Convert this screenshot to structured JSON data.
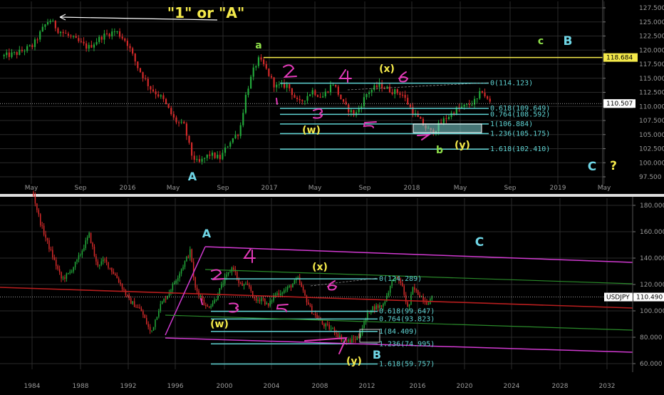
{
  "colors": {
    "background": "#000000",
    "grid": "#2a2a2a",
    "axis_text": "#9a9a9a",
    "separator": "#dddddd",
    "candle_up": "#22a83a",
    "candle_down": "#d42a2a",
    "fib": "#5fd3d3",
    "magenta": "#d23ad2",
    "cyan_label": "#6fd6e6",
    "yellow": "#f4e94a",
    "green_label": "#8fe04a",
    "pink_wave": "#e23ab8",
    "channel_green": "#2a8a2a",
    "trend_red": "#b81e1e",
    "price_line": "#cfcfcf"
  },
  "chart_data": [
    {
      "type": "candlestick",
      "symbol": "USDJPY",
      "last_price_label": "110.507",
      "marked_level_label": "118.684",
      "y_ticks": [
        "127.500",
        "125.000",
        "122.500",
        "120.000",
        "117.500",
        "115.000",
        "112.500",
        "110.000",
        "107.500",
        "105.000",
        "102.500",
        "100.000",
        "97.500"
      ],
      "ylim": [
        96.5,
        128.3
      ],
      "x_ticks": [
        "May",
        "Sep",
        "2016",
        "May",
        "Sep",
        "2017",
        "May",
        "Sep",
        "2018",
        "May",
        "Sep",
        "2019",
        "May"
      ],
      "xlim": [
        2015.08,
        2019.46
      ],
      "price_path": [
        [
          2015.1,
          118.9
        ],
        [
          2015.2,
          119.4
        ],
        [
          2015.32,
          120.8
        ],
        [
          2015.4,
          124.2
        ],
        [
          2015.44,
          125.5
        ],
        [
          2015.5,
          123.6
        ],
        [
          2015.62,
          121.9
        ],
        [
          2015.72,
          120.4
        ],
        [
          2015.82,
          122.4
        ],
        [
          2015.92,
          123.4
        ],
        [
          2016.0,
          121.5
        ],
        [
          2016.08,
          117.0
        ],
        [
          2016.17,
          113.3
        ],
        [
          2016.26,
          111.4
        ],
        [
          2016.35,
          107.5
        ],
        [
          2016.42,
          106.5
        ],
        [
          2016.47,
          101.5
        ],
        [
          2016.52,
          99.8
        ],
        [
          2016.6,
          101.5
        ],
        [
          2016.68,
          100.8
        ],
        [
          2016.75,
          103.8
        ],
        [
          2016.82,
          105.5
        ],
        [
          2016.87,
          112.5
        ],
        [
          2016.93,
          117.0
        ],
        [
          2016.96,
          118.3
        ],
        [
          2017.0,
          117.2
        ],
        [
          2017.08,
          113.5
        ],
        [
          2017.17,
          113.8
        ],
        [
          2017.25,
          110.4
        ],
        [
          2017.35,
          112.8
        ],
        [
          2017.42,
          111.6
        ],
        [
          2017.5,
          114.2
        ],
        [
          2017.58,
          110.2
        ],
        [
          2017.66,
          108.4
        ],
        [
          2017.75,
          112.5
        ],
        [
          2017.84,
          113.8
        ],
        [
          2017.92,
          112.8
        ],
        [
          2018.0,
          112.3
        ],
        [
          2018.08,
          109.0
        ],
        [
          2018.17,
          106.3
        ],
        [
          2018.22,
          105.3
        ],
        [
          2018.3,
          107.5
        ],
        [
          2018.4,
          109.5
        ],
        [
          2018.48,
          110.2
        ],
        [
          2018.55,
          111.2
        ],
        [
          2018.58,
          113.0
        ],
        [
          2018.62,
          111.2
        ],
        [
          2018.65,
          110.5
        ]
      ],
      "fib_levels": [
        {
          "label": "0(114.123)",
          "value": 114.123
        },
        {
          "label": "0.618(109.649)",
          "value": 109.649
        },
        {
          "label": "0.764(108.592)",
          "value": 108.592
        },
        {
          "label": "1(106.884)",
          "value": 106.884
        },
        {
          "label": "1.236(105.175)",
          "value": 105.175
        },
        {
          "label": "1.618(102.410)",
          "value": 102.41
        }
      ],
      "annotations": [
        "\"1\" or \"A\"",
        "a",
        "(x)",
        "(w)",
        "b",
        "(y)",
        "c",
        "B",
        "C",
        "?",
        "A"
      ]
    },
    {
      "type": "candlestick",
      "symbol": "USDJPY",
      "last_price_label": "110.490",
      "y_ticks": [
        "180.000",
        "160.000",
        "140.000",
        "120.000",
        "100.000",
        "80.000",
        "60.000"
      ],
      "ylim": [
        52,
        187
      ],
      "x_ticks": [
        "1984",
        "1988",
        "1992",
        "1996",
        "2000",
        "2004",
        "2008",
        "2012",
        "2016",
        "2020",
        "2024",
        "2028",
        "2032"
      ],
      "xlim": [
        1982.8,
        2035.2
      ],
      "price_path": [
        [
          1985.5,
          190
        ],
        [
          1986.2,
          165
        ],
        [
          1987.0,
          145
        ],
        [
          1987.9,
          124
        ],
        [
          1988.5,
          128
        ],
        [
          1989.2,
          138
        ],
        [
          1990.2,
          158
        ],
        [
          1990.8,
          135
        ],
        [
          1991.5,
          138
        ],
        [
          1992.5,
          125
        ],
        [
          1993.5,
          108
        ],
        [
          1994.5,
          100
        ],
        [
          1995.3,
          83
        ],
        [
          1996.0,
          103
        ],
        [
          1996.8,
          114
        ],
        [
          1997.5,
          126
        ],
        [
          1998.6,
          146
        ],
        [
          1998.9,
          118
        ],
        [
          1999.5,
          110
        ],
        [
          1999.9,
          102
        ],
        [
          2000.6,
          108
        ],
        [
          2001.3,
          122
        ],
        [
          2002.1,
          134
        ],
        [
          2002.6,
          120
        ],
        [
          2003.5,
          118
        ],
        [
          2003.9,
          107
        ],
        [
          2004.5,
          110
        ],
        [
          2005.0,
          103
        ],
        [
          2005.5,
          112
        ],
        [
          2006.5,
          116
        ],
        [
          2007.5,
          124
        ],
        [
          2008.0,
          112
        ],
        [
          2008.6,
          100
        ],
        [
          2009.5,
          90
        ],
        [
          2010.5,
          85
        ],
        [
          2011.2,
          77
        ],
        [
          2011.8,
          77
        ],
        [
          2012.5,
          80
        ],
        [
          2013.0,
          92
        ],
        [
          2013.5,
          102
        ],
        [
          2014.5,
          104
        ],
        [
          2015.4,
          125
        ],
        [
          2016.0,
          122
        ],
        [
          2016.6,
          101
        ],
        [
          2017.0,
          117
        ],
        [
          2017.7,
          111
        ],
        [
          2018.2,
          106
        ],
        [
          2018.65,
          110.5
        ]
      ],
      "fib_levels": [
        {
          "label": "0(124.289)",
          "value": 124.289
        },
        {
          "label": "0.618(99.647)",
          "value": 99.647
        },
        {
          "label": "0.764(93.823)",
          "value": 93.823
        },
        {
          "label": "1(84.409)",
          "value": 84.409
        },
        {
          "label": "1.236(74.995)",
          "value": 74.995
        },
        {
          "label": "1.618(59.757)",
          "value": 59.757
        }
      ],
      "annotations": [
        "A",
        "(x)",
        "(w)",
        "B",
        "(y)",
        "C"
      ]
    }
  ]
}
